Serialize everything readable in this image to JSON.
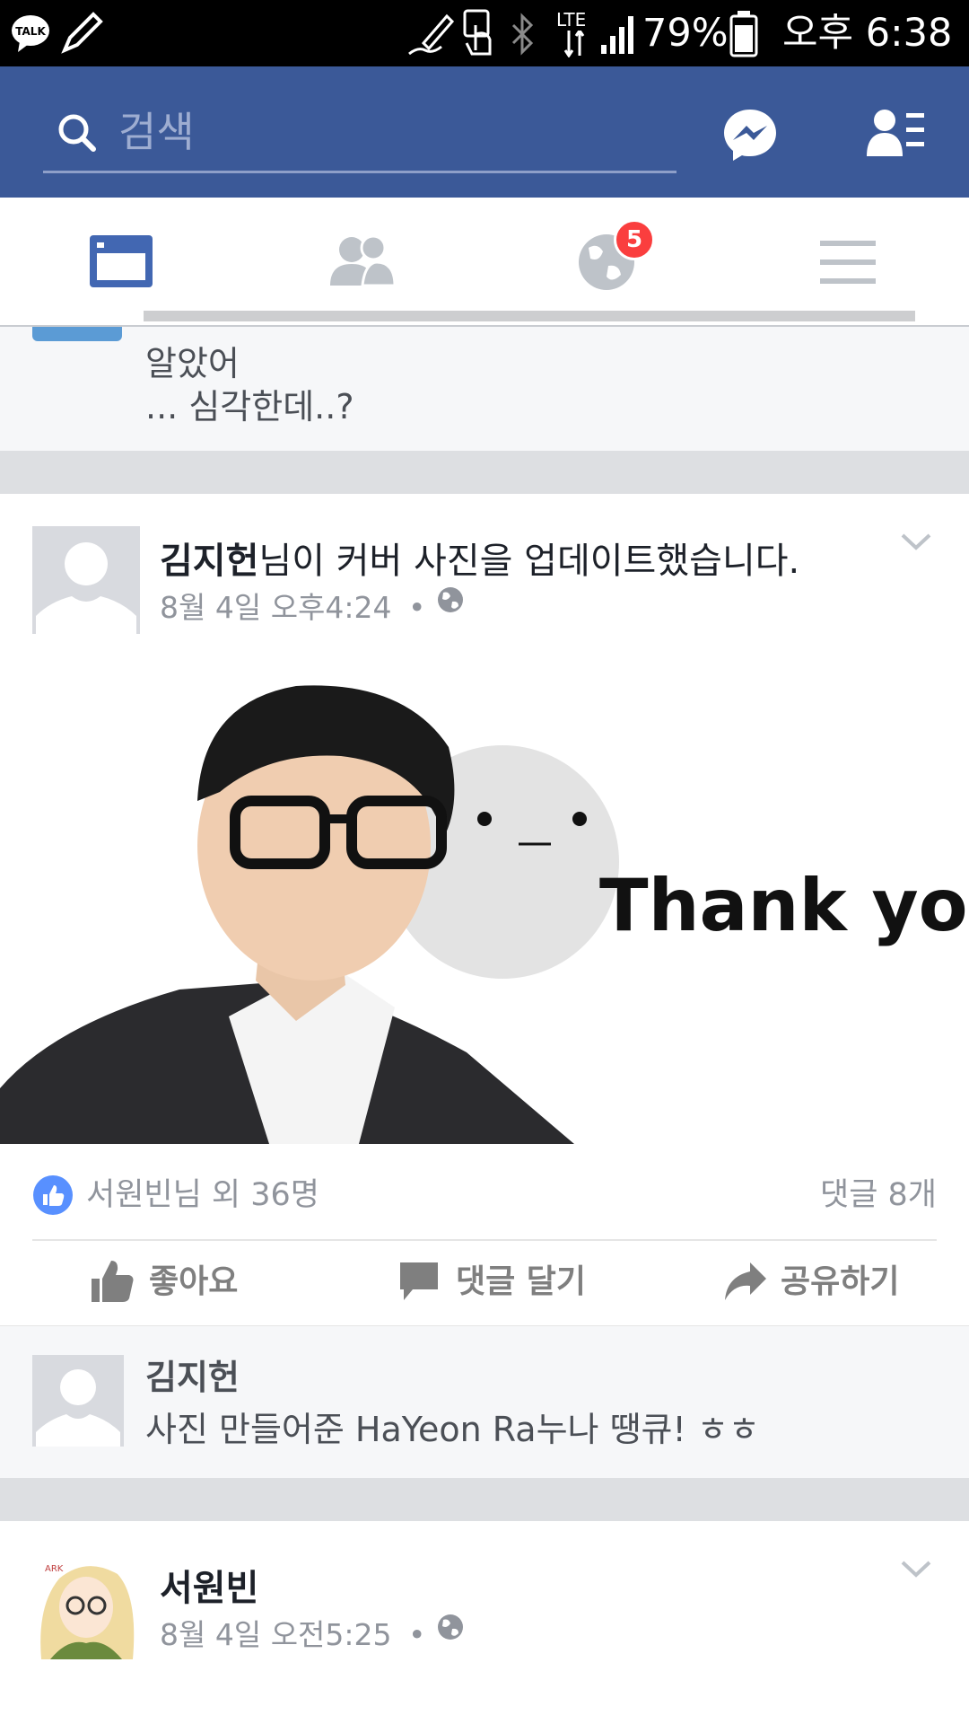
{
  "status_bar": {
    "battery": "79%",
    "time": "오후 6:38",
    "network": "LTE",
    "icons": [
      "kakaotalk-icon",
      "pen-icon",
      "s-pen-icon",
      "touch-icon",
      "bluetooth-icon",
      "lte-icon",
      "signal-icon",
      "battery-icon"
    ]
  },
  "top_bar": {
    "search_placeholder": "검색",
    "icons": [
      "search-icon",
      "messenger-icon",
      "friend-requests-icon"
    ]
  },
  "tabs": {
    "icons": [
      "news-feed-icon",
      "friends-icon",
      "notifications-globe-icon",
      "menu-icon"
    ],
    "notification_badge": "5"
  },
  "prev_post": {
    "comment_line2": "알았어",
    "comment_line3": "... 심각한데..?"
  },
  "post1": {
    "author": "김지헌",
    "action": "님이 커버 사진을 업데이트했습니다.",
    "date": "8월 4일 오후4:24",
    "dot": "•",
    "image_text": "Thank you",
    "likes_text": "서원빈님 외 36명",
    "comments_count": "댓글 8개",
    "actions": {
      "like": "좋아요",
      "comment": "댓글 달기",
      "share": "공유하기"
    },
    "comment": {
      "author": "김지헌",
      "text": "사진 만들어준 HaYeon Ra누나 땡큐! ㅎㅎ"
    }
  },
  "post2": {
    "author": "서원빈",
    "date": "8월 4일 오전5:25",
    "dot": "•"
  },
  "colors": {
    "facebook_blue": "#3b5998",
    "active_tab": "#4267b2",
    "inactive_tab": "#bec3c9",
    "badge_red": "#fa3e3e",
    "like_blue": "#5890ff"
  }
}
